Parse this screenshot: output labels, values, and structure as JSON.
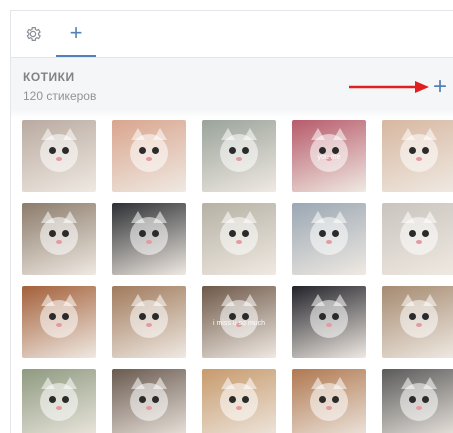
{
  "tabs": {
    "settings_icon": "gear-icon",
    "add_label": "+"
  },
  "pack": {
    "name": "КОТИКИ",
    "count": "120 стикеров",
    "add_label": "+"
  },
  "colors": {
    "accent": "#5181b8",
    "arrow": "#e02020",
    "header_bg": "#f5f6f8"
  },
  "stickers": [
    {
      "caption": "",
      "bg": "#b9aaa0"
    },
    {
      "caption": "",
      "bg": "#d9a58e"
    },
    {
      "caption": "",
      "bg": "#9aa39a"
    },
    {
      "caption": "you me",
      "bg": "#b75a6a"
    },
    {
      "caption": "",
      "bg": "#d7b7a0"
    },
    {
      "caption": "",
      "bg": "#8b7b6b"
    },
    {
      "caption": "",
      "bg": "#2d2f33"
    },
    {
      "caption": "",
      "bg": "#b6b1a4"
    },
    {
      "caption": "",
      "bg": "#9aa7b3"
    },
    {
      "caption": "",
      "bg": "#c9c4bd"
    },
    {
      "caption": "",
      "bg": "#a3603a"
    },
    {
      "caption": "",
      "bg": "#a07a5c"
    },
    {
      "caption": "i miss u so much",
      "bg": "#6e5848"
    },
    {
      "caption": "",
      "bg": "#222229"
    },
    {
      "caption": "",
      "bg": "#a58a70"
    },
    {
      "caption": "",
      "bg": "#8e9a80"
    },
    {
      "caption": "",
      "bg": "#6a5a50"
    },
    {
      "caption": "",
      "bg": "#c79a6c"
    },
    {
      "caption": "",
      "bg": "#b07850"
    },
    {
      "caption": "",
      "bg": "#5a5a5a"
    }
  ]
}
